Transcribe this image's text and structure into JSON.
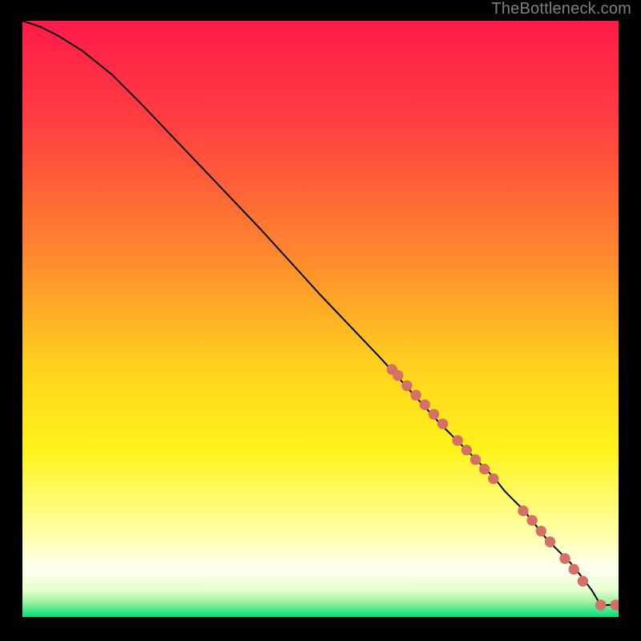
{
  "attribution": "TheBottleneck.com",
  "chart_data": {
    "type": "line",
    "title": "",
    "xlabel": "",
    "ylabel": "",
    "xlim": [
      0,
      100
    ],
    "ylim": [
      0,
      100
    ],
    "background_gradient": {
      "stops": [
        {
          "offset": 0.0,
          "color": "#ff1a4a"
        },
        {
          "offset": 0.18,
          "color": "#ff4140"
        },
        {
          "offset": 0.4,
          "color": "#ff8a2e"
        },
        {
          "offset": 0.58,
          "color": "#ffd21e"
        },
        {
          "offset": 0.72,
          "color": "#fff31a"
        },
        {
          "offset": 0.86,
          "color": "#ffffa8"
        },
        {
          "offset": 0.92,
          "color": "#fffff0"
        },
        {
          "offset": 0.955,
          "color": "#e6ffd0"
        },
        {
          "offset": 0.975,
          "color": "#a0f0a0"
        },
        {
          "offset": 1.0,
          "color": "#00e07a"
        }
      ]
    },
    "series": [
      {
        "name": "bottleneck-curve",
        "color": "#000000",
        "x": [
          0,
          3,
          6,
          10,
          15,
          20,
          30,
          40,
          50,
          60,
          65,
          70,
          72,
          75,
          77,
          79,
          81,
          84,
          86,
          88,
          90,
          92,
          94,
          95.5,
          97,
          100
        ],
        "y": [
          100,
          99,
          97.5,
          95,
          91,
          86,
          75.5,
          65,
          54,
          43.5,
          38,
          32.5,
          30.5,
          27.5,
          25.5,
          23.5,
          21,
          18,
          15.5,
          13,
          11,
          9,
          6.5,
          4.5,
          2,
          2
        ]
      }
    ],
    "markers": {
      "color": "#d57066",
      "radius_pct": 0.9,
      "points": [
        {
          "x": 62.0,
          "y": 41.5
        },
        {
          "x": 63.0,
          "y": 40.5
        },
        {
          "x": 64.5,
          "y": 38.8
        },
        {
          "x": 66.0,
          "y": 37.2
        },
        {
          "x": 67.5,
          "y": 35.6
        },
        {
          "x": 69.0,
          "y": 34.0
        },
        {
          "x": 70.5,
          "y": 32.4
        },
        {
          "x": 73.0,
          "y": 29.6
        },
        {
          "x": 74.5,
          "y": 28.0
        },
        {
          "x": 76.0,
          "y": 26.4
        },
        {
          "x": 77.5,
          "y": 24.8
        },
        {
          "x": 79.0,
          "y": 23.2
        },
        {
          "x": 84.0,
          "y": 17.8
        },
        {
          "x": 85.5,
          "y": 16.2
        },
        {
          "x": 87.0,
          "y": 14.4
        },
        {
          "x": 88.5,
          "y": 12.6
        },
        {
          "x": 91.0,
          "y": 9.8
        },
        {
          "x": 92.5,
          "y": 8.0
        },
        {
          "x": 94.0,
          "y": 6.0
        },
        {
          "x": 97.0,
          "y": 2.0
        },
        {
          "x": 99.5,
          "y": 2.0
        }
      ]
    }
  }
}
